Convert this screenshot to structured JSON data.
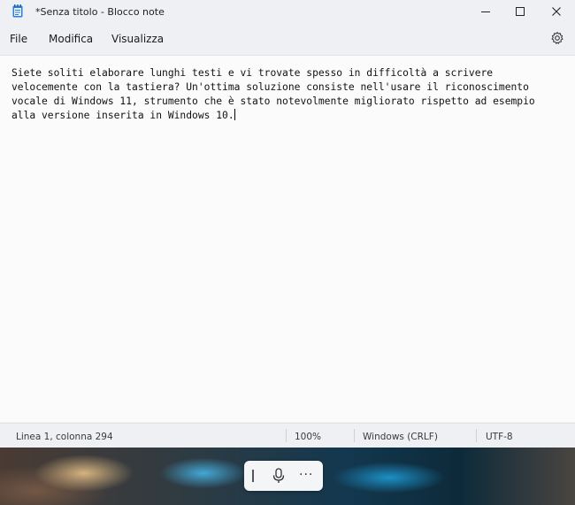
{
  "window": {
    "title": "*Senza titolo - Blocco note",
    "icon": "notepad-icon",
    "controls": {
      "minimize": "—",
      "maximize": "☐",
      "close": "✕"
    }
  },
  "menu": {
    "items": [
      {
        "label": "File"
      },
      {
        "label": "Modifica"
      },
      {
        "label": "Visualizza"
      }
    ],
    "settings_icon": "gear-icon"
  },
  "editor": {
    "text": "Siete soliti elaborare lunghi testi e vi trovate spesso in difficoltà a scrivere\nvelocemente con la tastiera? Un'ottima soluzione consiste nell'usare il riconoscimento\nvocale di Windows 11, strumento che è stato notevolmente migliorato rispetto ad esempio\nalla versione inserita in Windows 10."
  },
  "status": {
    "position": "Linea 1, colonna 294",
    "zoom": "100%",
    "line_ending": "Windows (CRLF)",
    "encoding": "UTF-8"
  },
  "voice_typing": {
    "mic_icon": "microphone-icon",
    "more_label": "···"
  }
}
